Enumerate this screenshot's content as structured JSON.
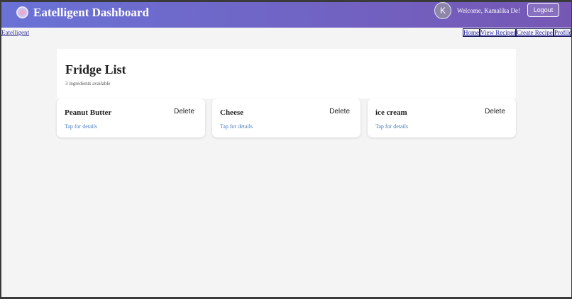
{
  "header": {
    "app_title": "Eatelligent Dashboard",
    "avatar_initial": "K",
    "welcome_text": "Welcome, Kamalika De!",
    "logout_label": "Logout"
  },
  "nav": {
    "brand": "Eatelligent",
    "links": [
      "Home",
      "View Recipes",
      "Create Recipe",
      "Profile"
    ]
  },
  "fridge": {
    "title": "Fridge List",
    "count_text": "3 ingredients available",
    "items": [
      {
        "name": "Peanut Butter",
        "delete_label": "Delete",
        "details_label": "Tap for details"
      },
      {
        "name": "Cheese",
        "delete_label": "Delete",
        "details_label": "Tap for details"
      },
      {
        "name": "ice cream",
        "delete_label": "Delete",
        "details_label": "Tap for details"
      }
    ]
  },
  "colors": {
    "header_gradient_start": "#6a72d6",
    "header_gradient_end": "#7657b4",
    "link_blue": "#4a7fbf",
    "page_background": "#f4f4f4"
  }
}
